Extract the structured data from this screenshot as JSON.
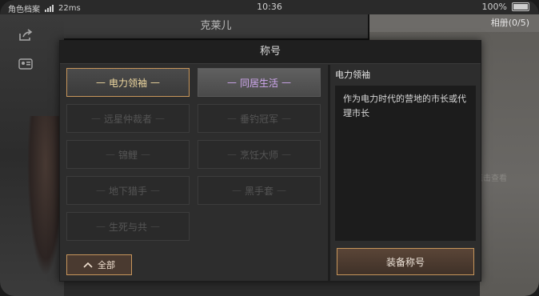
{
  "status_bar": {
    "carrier": "角色档案",
    "network": "22ms",
    "time": "10:36",
    "battery": "100%"
  },
  "background": {
    "character_name": "克莱儿",
    "album_tab": "相册(0/5)",
    "partial_right_text": "点击查看"
  },
  "dialog": {
    "title": "称号",
    "titles": [
      {
        "label": "电力领袖",
        "state": "selected"
      },
      {
        "label": "同居生活",
        "state": "unlocked"
      },
      {
        "label": "远星仲裁者",
        "state": "locked"
      },
      {
        "label": "垂钓冠军",
        "state": "locked"
      },
      {
        "label": "锦鲤",
        "state": "locked"
      },
      {
        "label": "烹饪大师",
        "state": "locked"
      },
      {
        "label": "地下猎手",
        "state": "locked"
      },
      {
        "label": "黑手套",
        "state": "locked"
      },
      {
        "label": "生死与共",
        "state": "locked"
      }
    ],
    "detail": {
      "name": "电力领袖",
      "description": "作为电力时代的营地的市长或代理市长"
    },
    "filter_button": "全部",
    "equip_button": "装备称号",
    "accent_color": "#c7965b",
    "purple_text_color": "#d0a8f0"
  }
}
